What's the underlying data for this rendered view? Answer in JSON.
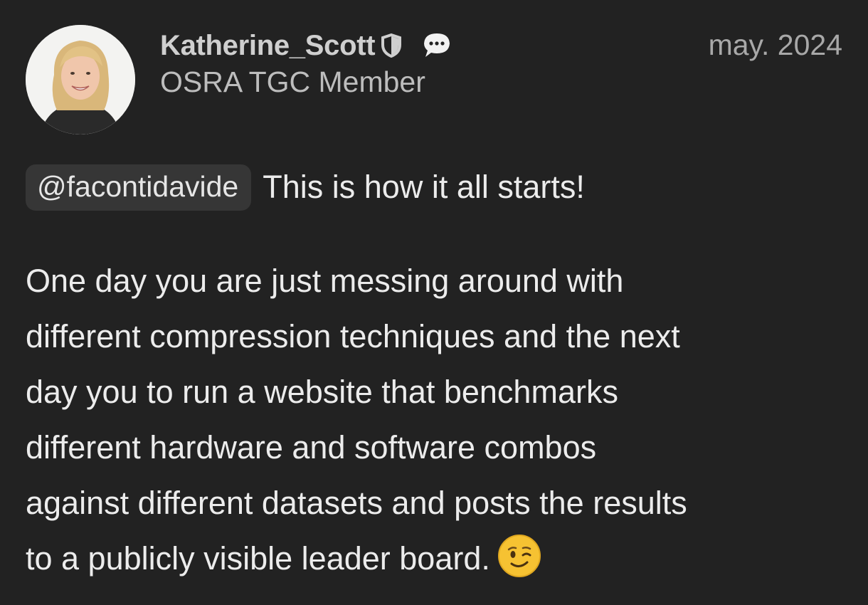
{
  "author": {
    "username": "Katherine_Scott",
    "title": "OSRA TGC Member",
    "avatar_icon": "profile-photo",
    "badge_icon": "shield-icon",
    "message_icon": "chat-bubble-icon"
  },
  "post": {
    "date": "may. 2024",
    "mention": "@facontidavide",
    "first_line": "This is how it all starts!",
    "paragraph_lines": [
      "One day you are just messing around with",
      "different compression techniques and the next",
      "day you to run a website that benchmarks",
      "different hardware and software combos",
      "against different datasets and posts the results",
      "to a publicly visible leader board."
    ],
    "emoji_icon": "winking-face-icon"
  },
  "colors": {
    "background": "#222222",
    "text": "#ececec",
    "muted": "#bdbdbd",
    "mention_bg": "#363636",
    "emoji": "#f6c232"
  }
}
